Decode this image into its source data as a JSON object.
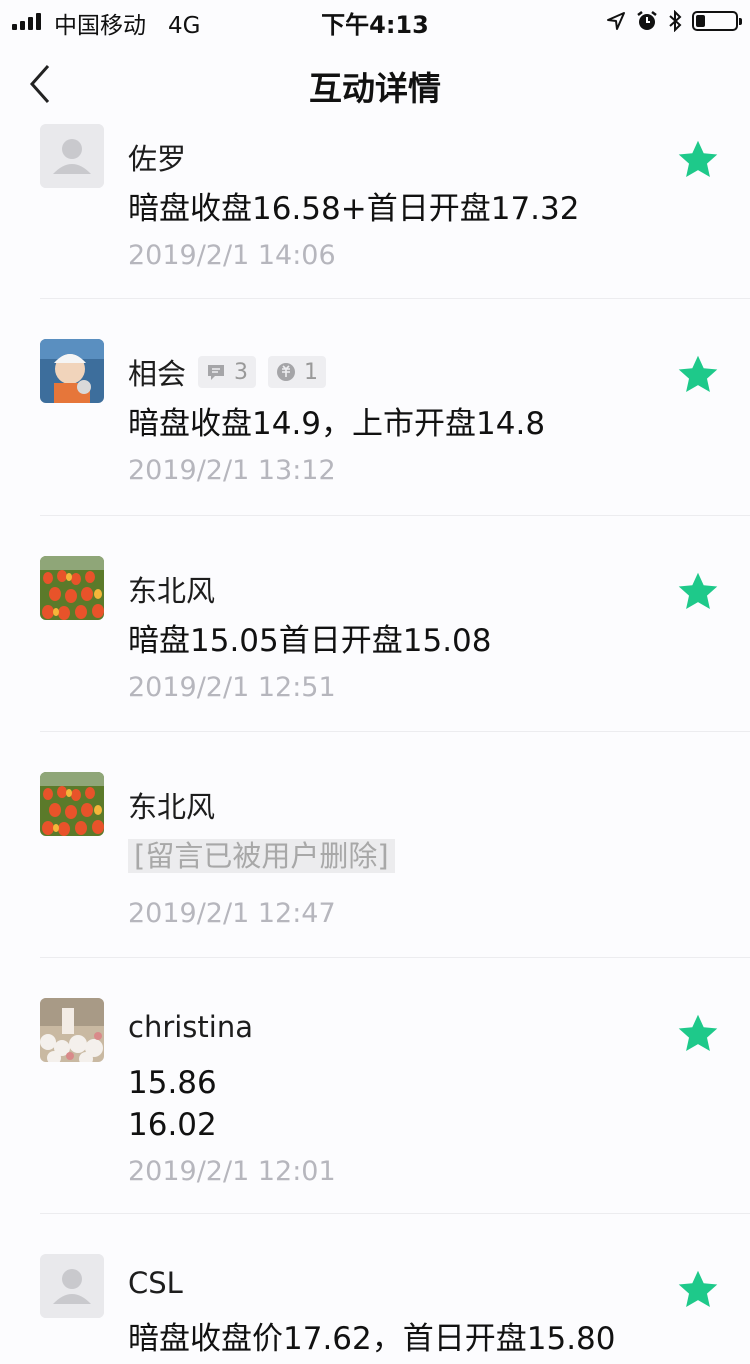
{
  "status_bar": {
    "carrier": "中国移动",
    "network": "4G",
    "time": "下午4:13",
    "battery_level": 0.2
  },
  "nav": {
    "title": "互动详情"
  },
  "colors": {
    "star": "#1ec98a",
    "timestamp": "#b6b6bd"
  },
  "comments": [
    {
      "name": "佐罗",
      "avatar": "default-avatar",
      "content": "暗盘收盘16.58+首日开盘17.32",
      "time": "2019/2/1 14:06",
      "starred": true
    },
    {
      "name": "相会",
      "avatar": "baby-photo-avatar",
      "replies": "3",
      "likes": "1",
      "content": "暗盘收盘14.9，上市开盘14.8",
      "time": "2019/2/1 13:12",
      "starred": true
    },
    {
      "name": "东北风",
      "avatar": "tulips-photo-avatar",
      "content": "暗盘15.05首日开盘15.08",
      "time": "2019/2/1 12:51",
      "starred": true
    },
    {
      "name": "东北风",
      "avatar": "tulips-photo-avatar",
      "deleted_text": "[留言已被用户删除]",
      "time": "2019/2/1 12:47",
      "starred": false
    },
    {
      "name": "christina",
      "avatar": "flowers-photo-avatar",
      "content": "15.86\n16.02",
      "time": "2019/2/1 12:01",
      "starred": true
    },
    {
      "name": "CSL",
      "avatar": "default-avatar",
      "content": "暗盘收盘价17.62，首日开盘15.80",
      "starred": true
    }
  ]
}
